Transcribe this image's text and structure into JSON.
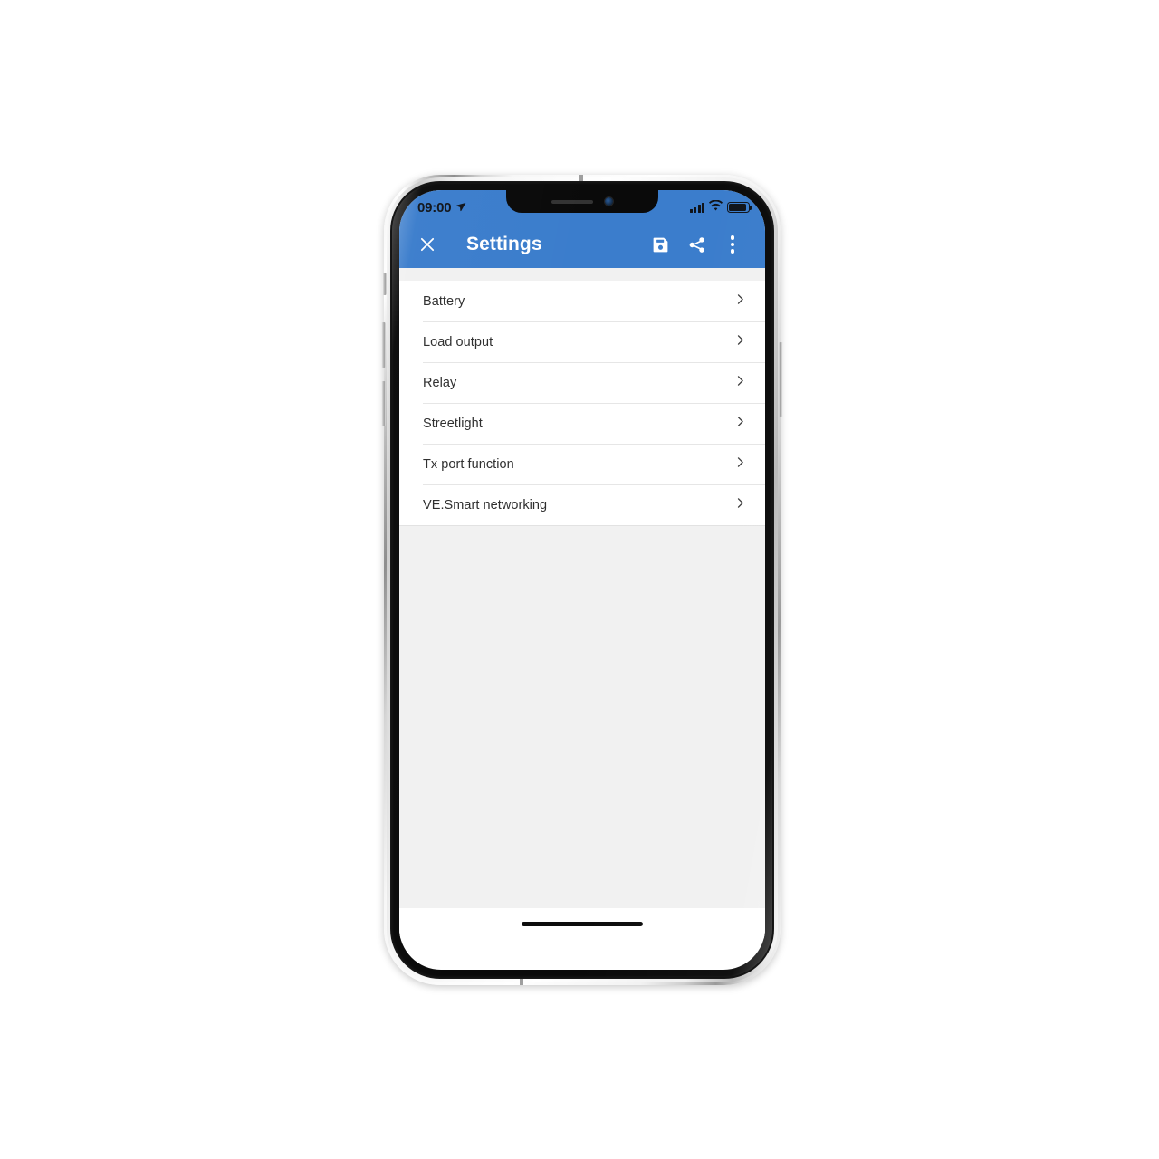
{
  "status_bar": {
    "time": "09:00",
    "location_icon": "location-arrow-icon",
    "signal_icon": "cellular-signal-icon",
    "wifi_icon": "wifi-icon",
    "battery_icon": "battery-icon"
  },
  "app_bar": {
    "close_label": "close-icon",
    "title": "Settings",
    "save_label": "save-icon",
    "share_label": "share-icon",
    "overflow_label": "more-options-icon"
  },
  "settings": {
    "items": [
      {
        "label": "Battery"
      },
      {
        "label": "Load output"
      },
      {
        "label": "Relay"
      },
      {
        "label": "Streetlight"
      },
      {
        "label": "Tx port function"
      },
      {
        "label": "VE.Smart networking"
      }
    ]
  },
  "colors": {
    "app_bar_blue": "#3b7dcc",
    "page_background": "#f1f1f1",
    "list_background": "#ffffff",
    "divider": "#e6e6e6",
    "text_primary": "#2e2e2e",
    "status_text": "#10141a",
    "outer_background": "#ffffff"
  }
}
